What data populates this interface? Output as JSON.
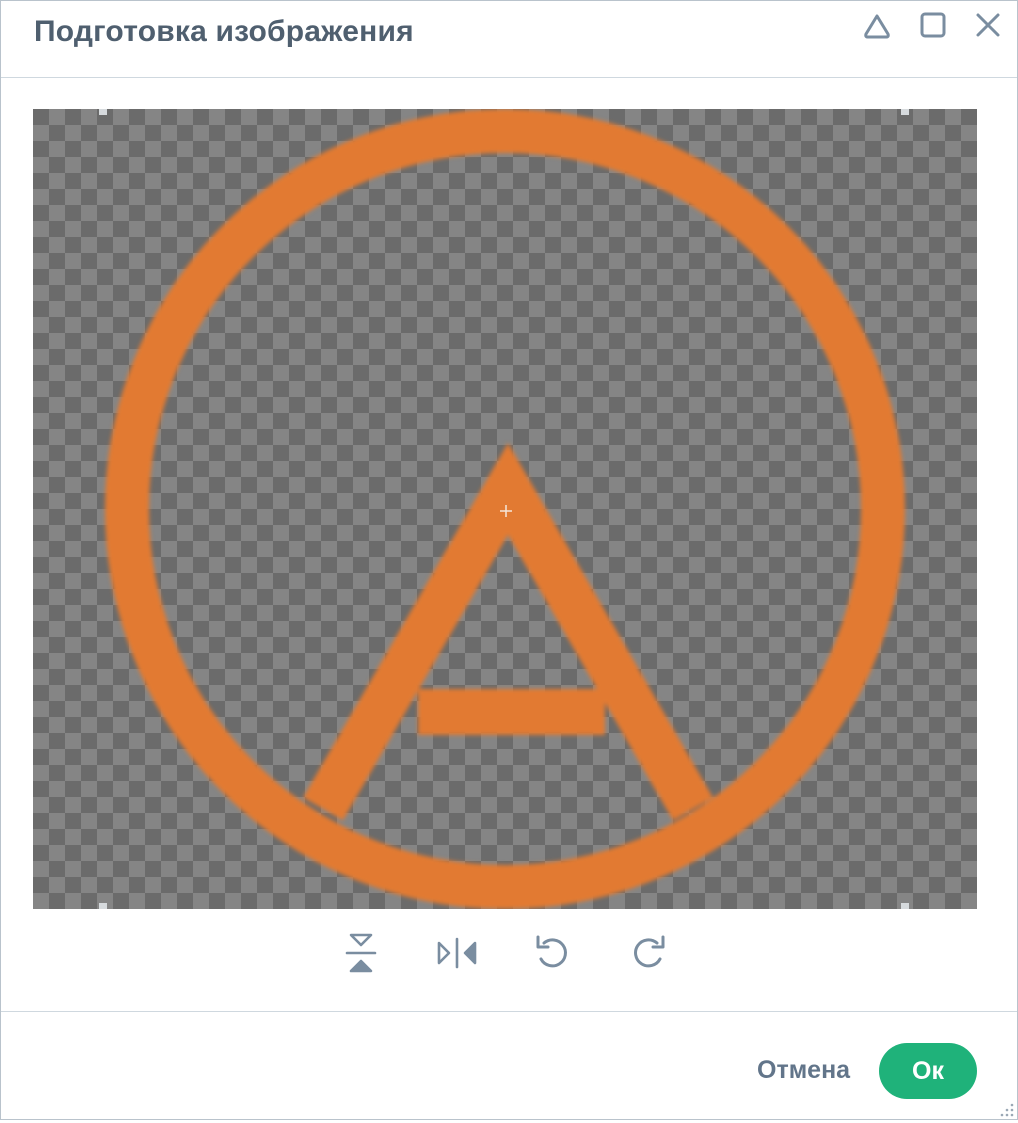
{
  "dialog": {
    "title": "Подготовка изображения",
    "window_controls": [
      {
        "name": "collapse",
        "icon": "triangle-collapse-icon"
      },
      {
        "name": "maximize",
        "icon": "square-maximize-icon"
      },
      {
        "name": "close",
        "icon": "close-icon"
      }
    ]
  },
  "canvas": {
    "background": "transparency-checkerboard",
    "logo_color": "#e27a30",
    "logo": "circle-with-letter-A"
  },
  "tools": [
    {
      "name": "flip-vertical",
      "icon": "flip-vertical-icon"
    },
    {
      "name": "flip-horizontal",
      "icon": "flip-horizontal-icon"
    },
    {
      "name": "rotate-left",
      "icon": "rotate-left-icon"
    },
    {
      "name": "rotate-right",
      "icon": "rotate-right-icon"
    }
  ],
  "footer": {
    "cancel_label": "Отмена",
    "ok_label": "Ок"
  },
  "colors": {
    "title_text": "#4f5f6f",
    "icon": "#7a8da0",
    "ok_button": "#1fb27a",
    "cancel_text": "#62758a",
    "border": "#cfd8df"
  }
}
